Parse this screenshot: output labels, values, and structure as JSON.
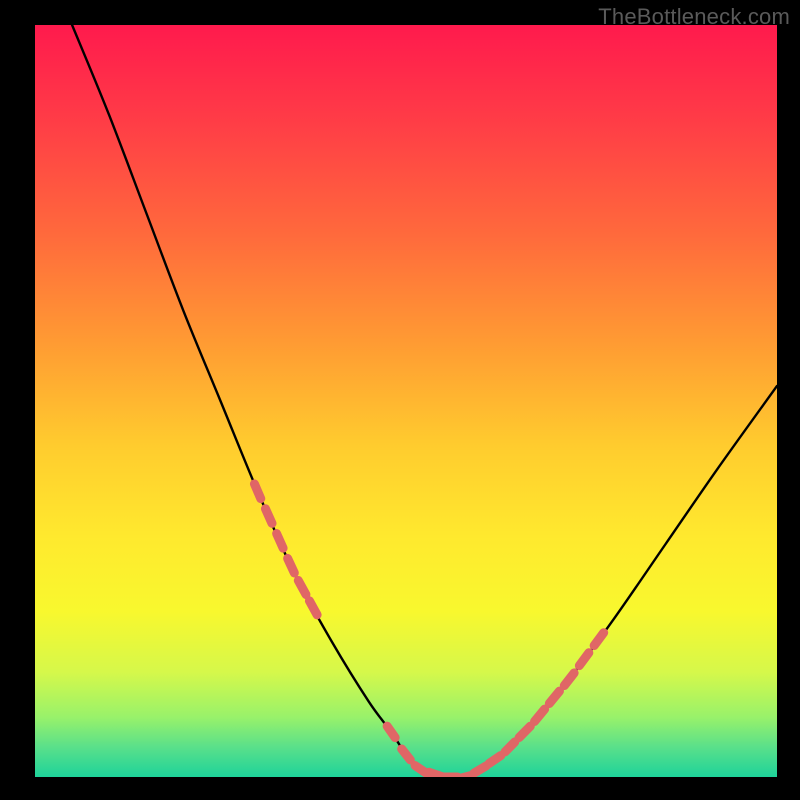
{
  "watermark": "TheBottleneck.com",
  "colors": {
    "page_bg": "#000000",
    "gradient_top": "#ff1a4d",
    "gradient_mid1": "#ff9a33",
    "gradient_mid2": "#ffe92e",
    "gradient_bottom": "#1ed39a",
    "curve": "#000000",
    "dash": "#e06666"
  },
  "chart_data": {
    "type": "line",
    "title": "",
    "xlabel": "",
    "ylabel": "",
    "xlim": [
      0,
      100
    ],
    "ylim": [
      0,
      100
    ],
    "legend": false,
    "grid": false,
    "series": [
      {
        "name": "bottleneck-curve",
        "x": [
          5,
          10,
          15,
          20,
          25,
          30,
          35,
          40,
          45,
          48,
          50,
          52,
          55,
          58,
          60,
          63,
          67,
          72,
          78,
          85,
          92,
          100
        ],
        "y": [
          100,
          88,
          75,
          62,
          50,
          38,
          27,
          18,
          10,
          6,
          3,
          1,
          0,
          0,
          1,
          3,
          7,
          13,
          21,
          31,
          41,
          52
        ]
      }
    ],
    "dash_segments": {
      "note": "x-positions along the curve where salmon dashed markers appear (two clusters on the curve's flanks near the floor, plus a run along the floor)",
      "left_flank_x": [
        30,
        31.5,
        33,
        34.5,
        36,
        37.5
      ],
      "floor_x": [
        48,
        50,
        52,
        54,
        56,
        58,
        60,
        62,
        64
      ],
      "right_flank_x": [
        66,
        68,
        70,
        72,
        74,
        76
      ]
    }
  }
}
